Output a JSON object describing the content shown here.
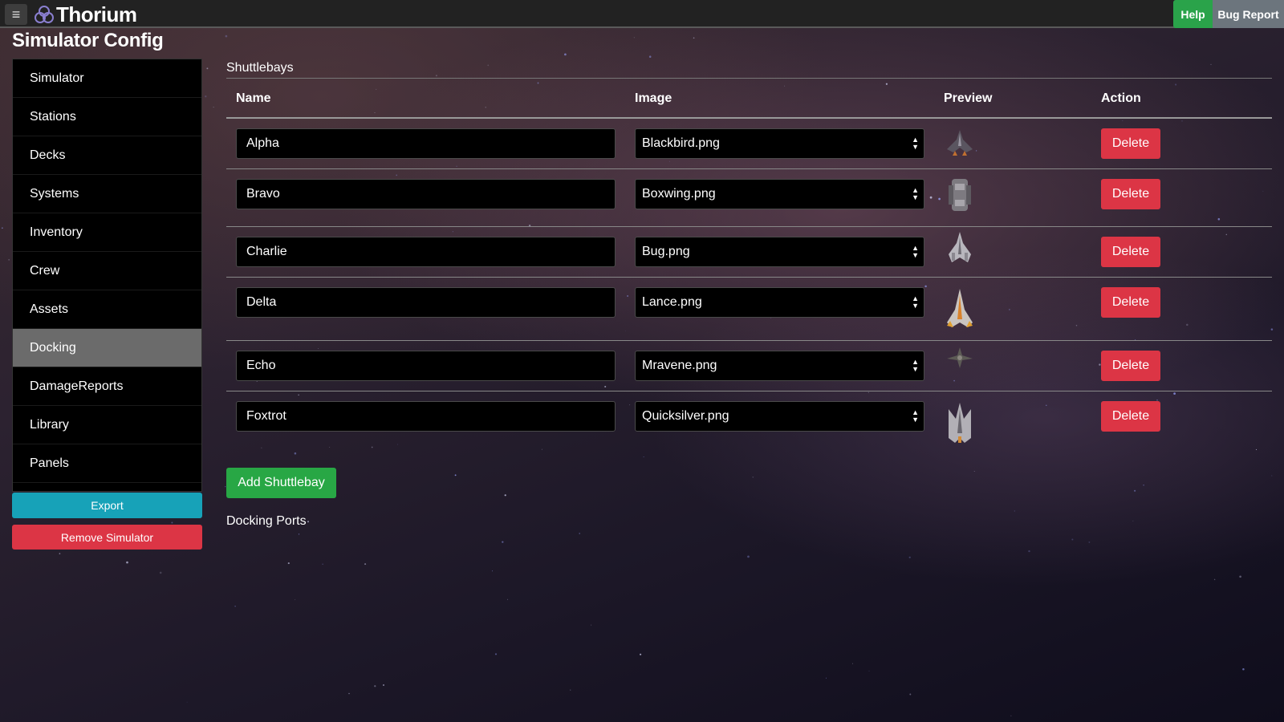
{
  "topbar": {
    "brand": "Thorium",
    "help_label": "Help",
    "bug_report_label": "Bug Report"
  },
  "page_title": "Simulator Config",
  "sidebar": {
    "items": [
      {
        "label": "Simulator",
        "active": false
      },
      {
        "label": "Stations",
        "active": false
      },
      {
        "label": "Decks",
        "active": false
      },
      {
        "label": "Systems",
        "active": false
      },
      {
        "label": "Inventory",
        "active": false
      },
      {
        "label": "Crew",
        "active": false
      },
      {
        "label": "Assets",
        "active": false
      },
      {
        "label": "Docking",
        "active": true
      },
      {
        "label": "DamageReports",
        "active": false
      },
      {
        "label": "Library",
        "active": false
      },
      {
        "label": "Panels",
        "active": false
      }
    ],
    "export_label": "Export",
    "remove_label": "Remove Simulator"
  },
  "shuttlebays": {
    "title": "Shuttlebays",
    "columns": [
      "Name",
      "Image",
      "Preview",
      "Action"
    ],
    "rows": [
      {
        "name": "Alpha",
        "image": "Blackbird.png",
        "preview_icon": "blackbird-ship-icon",
        "delete_label": "Delete"
      },
      {
        "name": "Bravo",
        "image": "Boxwing.png",
        "preview_icon": "boxwing-ship-icon",
        "delete_label": "Delete"
      },
      {
        "name": "Charlie",
        "image": "Bug.png",
        "preview_icon": "bug-ship-icon",
        "delete_label": "Delete"
      },
      {
        "name": "Delta",
        "image": "Lance.png",
        "preview_icon": "lance-ship-icon",
        "delete_label": "Delete"
      },
      {
        "name": "Echo",
        "image": "Mravene.png",
        "preview_icon": "mravene-ship-icon",
        "delete_label": "Delete"
      },
      {
        "name": "Foxtrot",
        "image": "Quicksilver.png",
        "preview_icon": "quicksilver-ship-icon",
        "delete_label": "Delete"
      }
    ],
    "add_label": "Add Shuttlebay"
  },
  "docking_ports": {
    "title": "Docking Ports"
  },
  "colors": {
    "help": "#2aa34a",
    "bug_report": "#6c757d",
    "export": "#17a2b8",
    "danger": "#dc3545",
    "add": "#28a745",
    "active_nav": "#6b6b6b"
  }
}
